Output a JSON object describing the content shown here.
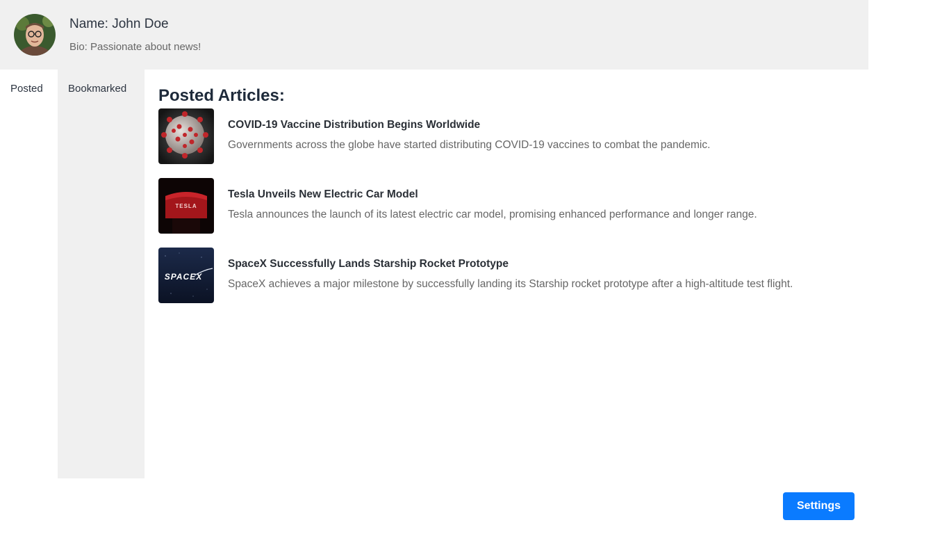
{
  "profile": {
    "name": "Name: John Doe",
    "bio": "Bio: Passionate about news!"
  },
  "tabs": {
    "posted": "Posted",
    "bookmarked": "Bookmarked"
  },
  "posted": {
    "heading": "Posted Articles:",
    "articles": [
      {
        "title": "COVID-19 Vaccine Distribution Begins Worldwide",
        "description": "Governments across the globe have started distributing COVID-19 vaccines to combat the pandemic.",
        "thumbnail": "virus-image"
      },
      {
        "title": "Tesla Unveils New Electric Car Model",
        "description": "Tesla announces the launch of its latest electric car model, promising enhanced performance and longer range.",
        "thumbnail": "tesla-image"
      },
      {
        "title": "SpaceX Successfully Lands Starship Rocket Prototype",
        "description": "SpaceX achieves a major milestone by successfully landing its Starship rocket prototype after a high-altitude test flight.",
        "thumbnail": "spacex-image"
      }
    ]
  },
  "thumb_text": {
    "tesla": "TESLA",
    "spacex": "SPACEX"
  },
  "actions": {
    "settings": "Settings"
  },
  "colors": {
    "accent": "#0a7bff",
    "panel": "#f0f0f0"
  }
}
